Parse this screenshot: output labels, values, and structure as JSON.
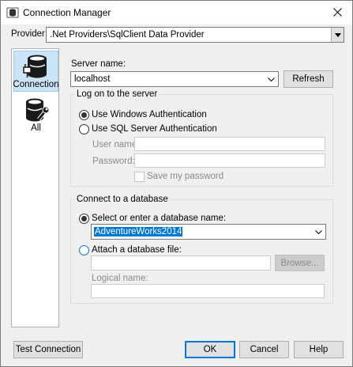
{
  "window": {
    "title": "Connection Manager"
  },
  "provider": {
    "label": "Provider:",
    "value": ".Net Providers\\SqlClient Data Provider"
  },
  "sidebar": {
    "items": [
      {
        "label": "Connection",
        "icon": "database-plug-icon"
      },
      {
        "label": "All",
        "icon": "database-wrench-icon"
      }
    ]
  },
  "server": {
    "label": "Server name:",
    "value": "localhost",
    "refresh_label": "Refresh"
  },
  "logon": {
    "group_title": "Log on to the server",
    "windows_auth_label": "Use Windows Authentication",
    "sql_auth_label": "Use SQL Server Authentication",
    "username_label": "User name:",
    "password_label": "Password:",
    "save_password_label": "Save my password"
  },
  "database": {
    "group_title": "Connect to a database",
    "select_label": "Select or enter a database name:",
    "database_value": "AdventureWorks2014",
    "attach_label": "Attach a database file:",
    "browse_label": "Browse...",
    "logical_name_label": "Logical name:"
  },
  "footer": {
    "test_label": "Test Connection",
    "ok_label": "OK",
    "cancel_label": "Cancel",
    "help_label": "Help"
  }
}
